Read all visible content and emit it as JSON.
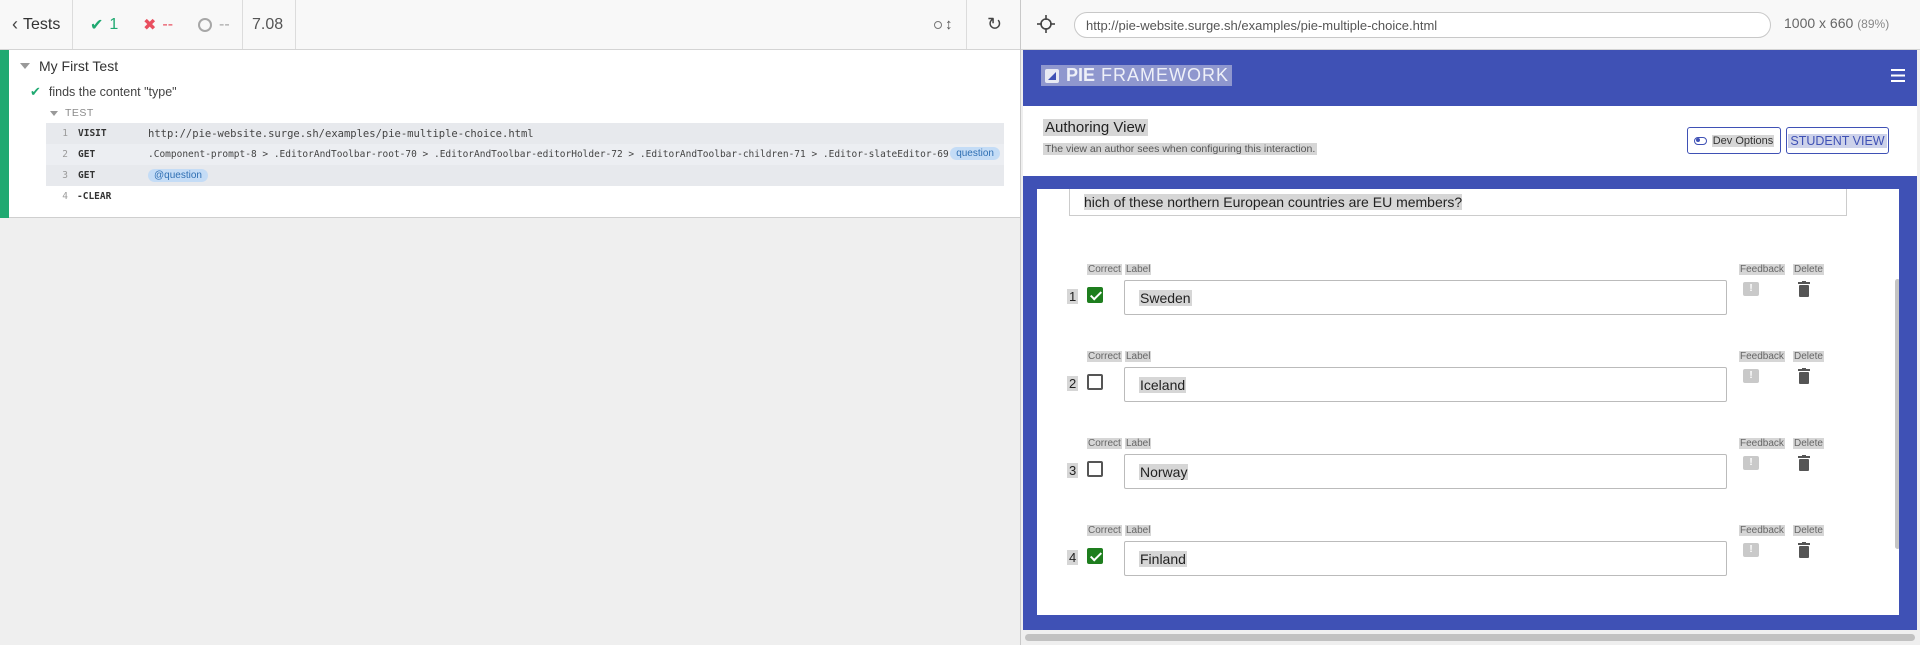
{
  "reporter": {
    "tests_label": "Tests",
    "passed": "1",
    "failed": "--",
    "pending": "--",
    "duration": "7.08",
    "suite_title": "My First Test",
    "test_title": "finds the content \"type\"",
    "section_label": "TEST",
    "commands": [
      {
        "num": "1",
        "name": "VISIT",
        "message": "http://pie-website.surge.sh/examples/pie-multiple-choice.html",
        "alias": ""
      },
      {
        "num": "2",
        "name": "GET",
        "message": ".Component-prompt-8 > .EditorAndToolbar-root-70 > .EditorAndToolbar-editorHolder-72 > .EditorAndToolbar-children-71 > .Editor-slateEditor-69",
        "alias": "question"
      },
      {
        "num": "3",
        "name": "GET",
        "message": "",
        "alias": "@question"
      },
      {
        "num": "4",
        "name": "-CLEAR",
        "message": "",
        "alias": ""
      }
    ]
  },
  "aut": {
    "url": "http://pie-website.surge.sh/examples/pie-multiple-choice.html",
    "viewport": "1000 x 660",
    "scale": "(89%)",
    "logo_bold": "PIE",
    "logo_light": "FRAMEWORK",
    "authoring_title": "Authoring View",
    "authoring_subtitle": "The view an author sees when configuring this interaction.",
    "dev_options_label": "Dev Options",
    "student_view_label": "STUDENT VIEW",
    "prompt_text": "hich of these northern European countries are EU members?",
    "col_correct": "Correct",
    "col_label": "Label",
    "col_feedback": "Feedback",
    "col_delete": "Delete",
    "choices": [
      {
        "num": "1",
        "label": "Sweden",
        "correct": true
      },
      {
        "num": "2",
        "label": "Iceland",
        "correct": false
      },
      {
        "num": "3",
        "label": "Norway",
        "correct": false
      },
      {
        "num": "4",
        "label": "Finland",
        "correct": true
      }
    ],
    "colors": {
      "primary": "#3f51b5",
      "pass": "#1fa971",
      "fail": "#e94f5f",
      "checked": "#1e7e1e"
    }
  }
}
